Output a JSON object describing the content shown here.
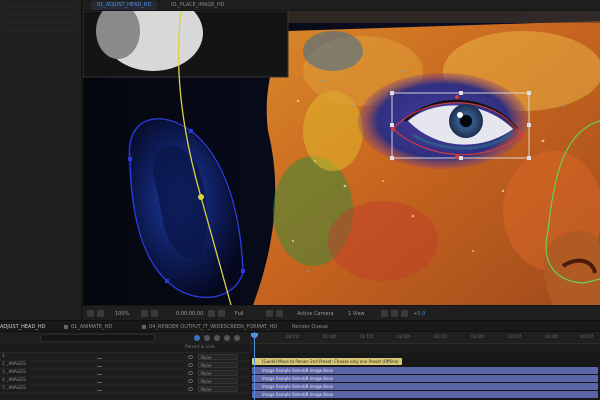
{
  "viewer": {
    "tabs": [
      {
        "label": "01_ADJUST_HEAD_HD",
        "active": true
      },
      {
        "label": "01_PLACE_IMAGE_HD",
        "active": false
      }
    ]
  },
  "viewer_toolbar": {
    "zoom": "100%",
    "timecode": "0:00:00:00",
    "resolution": "Full",
    "camera": "Active Camera",
    "views": "1 View",
    "exposure": "+0.0"
  },
  "timeline": {
    "tabs": [
      {
        "label": "ADJUST_HEAD_HD",
        "active": true
      },
      {
        "label": "01_ANIMATE_HD",
        "active": false
      },
      {
        "label": "04_RENDER OUTPUT_IT_WIDESCREEN_FORMAT_HD",
        "active": false
      },
      {
        "label": "Render Queue",
        "active": false
      }
    ],
    "headers": {
      "parent": "Parent & Link"
    },
    "ruler_ticks": [
      "00:15f",
      "01:00f",
      "01:15f",
      "02:00f",
      "02:15f",
      "03:00f",
      "03:15f",
      "04:00f",
      "04:15f"
    ],
    "layers": [
      {
        "name": "1",
        "mode": "None"
      },
      {
        "name": "2 _IMAGES",
        "mode": "None"
      },
      {
        "name": "3 _IMAGES",
        "mode": "None"
      },
      {
        "name": "4 _IMAGES",
        "mode": "None"
      },
      {
        "name": "5 _IMAGES",
        "mode": "None"
      }
    ],
    "bars": [
      {
        "label": "[Guide] Move to Person 2nd Preset: Choose only one Preset (Offline)",
        "color": "#d8c874"
      },
      {
        "label": "Image Sample Select/8 Image Base",
        "color": "#5a66a8"
      },
      {
        "label": "Image Sample Select/8 Image Base",
        "color": "#5a66a8"
      },
      {
        "label": "Image Sample Select/8 Image Base",
        "color": "#5a66a8"
      },
      {
        "label": "Image Sample Select/8 Image Base",
        "color": "#5a66a8"
      }
    ]
  },
  "colors": {
    "accent": "#4f8fe0",
    "mask_path": "#2a3ad8",
    "motion_path": "#d8d24a",
    "bbox": "#e0e0e0",
    "mask_point": "#e23a3a"
  }
}
